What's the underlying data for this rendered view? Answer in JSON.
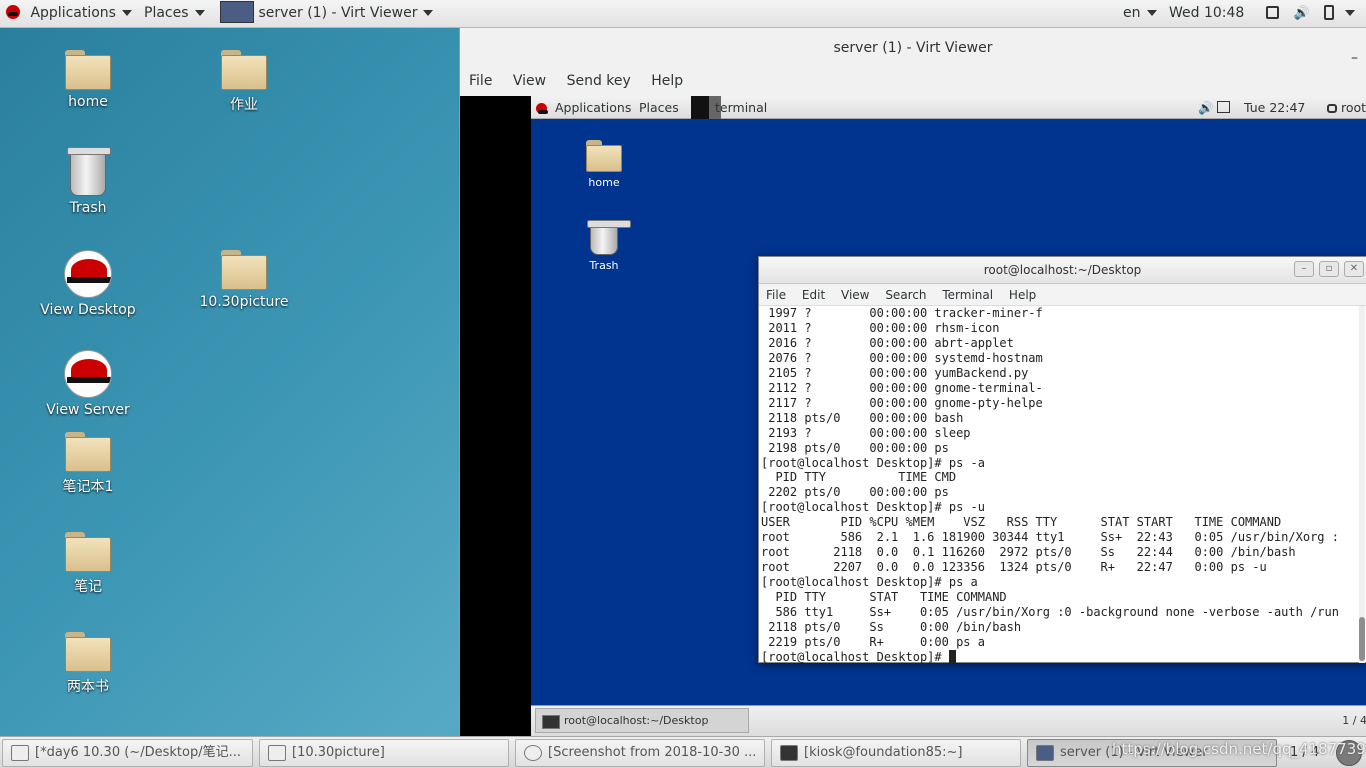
{
  "top_panel": {
    "applications": "Applications",
    "places": "Places",
    "active_window": "server (1) - Virt Viewer",
    "language": "en",
    "clock": "Wed 10:48"
  },
  "desktop_icons": [
    {
      "label": "home"
    },
    {
      "label": "作业"
    },
    {
      "label": "Trash"
    },
    {
      "label": "View Desktop"
    },
    {
      "label": "10.30picture"
    },
    {
      "label": "View Server"
    },
    {
      "label": "笔记本1"
    },
    {
      "label": "笔记"
    },
    {
      "label": "两本书"
    }
  ],
  "virt_viewer": {
    "title": "server (1) - Virt Viewer",
    "minimize": "–",
    "menu": [
      "File",
      "View",
      "Send key",
      "Help"
    ]
  },
  "guest": {
    "top_panel": {
      "applications": "Applications",
      "places": "Places",
      "terminal": "terminal",
      "clock": "Tue 22:47",
      "user": "root"
    },
    "desktop_icons": [
      {
        "label": "home"
      },
      {
        "label": "Trash"
      }
    ],
    "terminal": {
      "title": "root@localhost:~/Desktop",
      "menu": [
        "File",
        "Edit",
        "View",
        "Search",
        "Terminal",
        "Help"
      ],
      "lines": [
        " 1997 ?        00:00:00 tracker-miner-f",
        " 2011 ?        00:00:00 rhsm-icon",
        " 2016 ?        00:00:00 abrt-applet",
        " 2076 ?        00:00:00 systemd-hostnam",
        " 2105 ?        00:00:00 yumBackend.py",
        " 2112 ?        00:00:00 gnome-terminal-",
        " 2117 ?        00:00:00 gnome-pty-helpe",
        " 2118 pts/0    00:00:00 bash",
        " 2193 ?        00:00:00 sleep",
        " 2198 pts/0    00:00:00 ps",
        "[root@localhost Desktop]# ps -a",
        "  PID TTY          TIME CMD",
        " 2202 pts/0    00:00:00 ps",
        "[root@localhost Desktop]# ps -u",
        "USER       PID %CPU %MEM    VSZ   RSS TTY      STAT START   TIME COMMAND",
        "root       586  2.1  1.6 181900 30344 tty1     Ss+  22:43   0:05 /usr/bin/Xorg :",
        "root      2118  0.0  0.1 116260  2972 pts/0    Ss   22:44   0:00 /bin/bash",
        "root      2207  0.0  0.0 123356  1324 pts/0    R+   22:47   0:00 ps -u",
        "[root@localhost Desktop]# ps a",
        "  PID TTY      STAT   TIME COMMAND",
        "  586 tty1     Ss+    0:05 /usr/bin/Xorg :0 -background none -verbose -auth /run",
        " 2118 pts/0    Ss     0:00 /bin/bash",
        " 2219 pts/0    R+     0:00 ps a",
        "[root@localhost Desktop]# "
      ]
    },
    "bottom_task": "root@localhost:~/Desktop",
    "page": "1 / 4"
  },
  "taskbar": [
    {
      "label": "[*day6 10.30 (~/Desktop/笔记..."
    },
    {
      "label": "[10.30picture]"
    },
    {
      "label": "[Screenshot from 2018-10-30 ..."
    },
    {
      "label": "[kiosk@foundation85:~]"
    },
    {
      "label": "server (1) - Virt Viewer"
    }
  ],
  "taskbar_page": "1 / 4",
  "watermark": "https://blog.csdn.net/qq_41877397"
}
